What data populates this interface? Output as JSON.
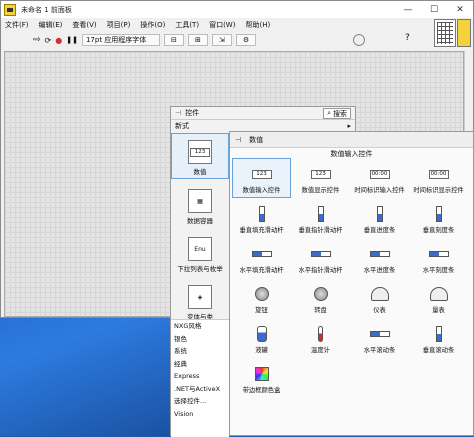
{
  "window": {
    "title": "未命名 1 前面板",
    "min": "—",
    "max": "☐",
    "close": "✕"
  },
  "menu": [
    "文件(F)",
    "编辑(E)",
    "查看(V)",
    "项目(P)",
    "操作(O)",
    "工具(T)",
    "窗口(W)",
    "帮助(H)"
  ],
  "toolbar": {
    "font": "17pt 应用程序字体",
    "run": "⇨",
    "run_cont": "⟳",
    "abort": "●",
    "pause": "❚❚",
    "align": "⊟",
    "distribute": "⊞",
    "resize": "⇲",
    "reorder": "⚙",
    "help": "?"
  },
  "palette": {
    "title": "控件",
    "search": "搜索",
    "custom": "新式",
    "categories": [
      {
        "label": "数值",
        "icon": "numeric-icon"
      },
      {
        "label": "数据容器",
        "icon": "data-container-icon"
      },
      {
        "label": "下拉列表与枚举",
        "icon": "ring-enum-icon"
      },
      {
        "label": "变体与类",
        "icon": "variant-class-icon"
      }
    ],
    "more": [
      "NXG风格",
      "银色",
      "系统",
      "经典",
      "Express",
      ".NET与ActiveX",
      "选择控件...",
      "Vision"
    ]
  },
  "subpalette": {
    "title": "数值",
    "section": "数值输入控件",
    "items": [
      {
        "label": "数值输入控件",
        "icon": "numeric-control-icon",
        "glyph": "123"
      },
      {
        "label": "数值显示控件",
        "icon": "numeric-indicator-icon",
        "glyph": "123"
      },
      {
        "label": "时间标识输入控件",
        "icon": "timestamp-control-icon",
        "glyph": "00:00"
      },
      {
        "label": "时间标识显示控件",
        "icon": "timestamp-indicator-icon",
        "glyph": "00:00"
      },
      {
        "label": "垂直填充滑动杆",
        "icon": "vertical-fill-slide-icon",
        "glyph": ""
      },
      {
        "label": "垂直指针滑动杆",
        "icon": "vertical-pointer-slide-icon",
        "glyph": ""
      },
      {
        "label": "垂直进度条",
        "icon": "vertical-progress-bar-icon",
        "glyph": ""
      },
      {
        "label": "垂直刻度条",
        "icon": "vertical-graduated-bar-icon",
        "glyph": ""
      },
      {
        "label": "水平填充滑动杆",
        "icon": "horizontal-fill-slide-icon",
        "glyph": ""
      },
      {
        "label": "水平指针滑动杆",
        "icon": "horizontal-pointer-slide-icon",
        "glyph": ""
      },
      {
        "label": "水平进度条",
        "icon": "horizontal-progress-bar-icon",
        "glyph": ""
      },
      {
        "label": "水平刻度条",
        "icon": "horizontal-graduated-bar-icon",
        "glyph": ""
      },
      {
        "label": "旋钮",
        "icon": "knob-icon",
        "glyph": ""
      },
      {
        "label": "转盘",
        "icon": "dial-icon",
        "glyph": ""
      },
      {
        "label": "仪表",
        "icon": "gauge-icon",
        "glyph": ""
      },
      {
        "label": "量表",
        "icon": "meter-icon",
        "glyph": ""
      },
      {
        "label": "液罐",
        "icon": "tank-icon",
        "glyph": ""
      },
      {
        "label": "温度计",
        "icon": "thermometer-icon",
        "glyph": ""
      },
      {
        "label": "水平滚动条",
        "icon": "horizontal-scrollbar-icon",
        "glyph": ""
      },
      {
        "label": "垂直滚动条",
        "icon": "vertical-scrollbar-icon",
        "glyph": ""
      },
      {
        "label": "带边框颜色盒",
        "icon": "framed-color-box-icon",
        "glyph": ""
      }
    ]
  }
}
